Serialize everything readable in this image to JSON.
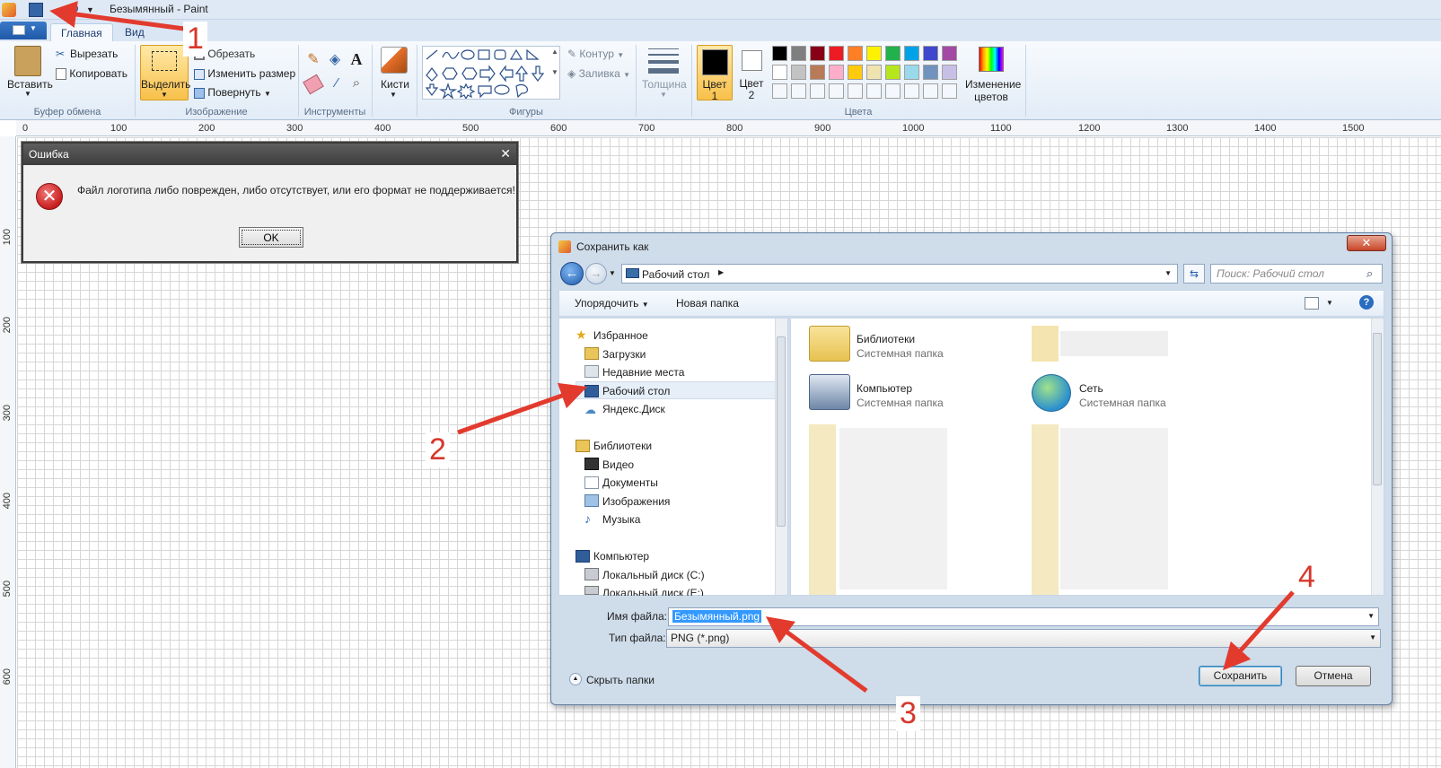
{
  "window": {
    "title": "Безымянный - Paint"
  },
  "tabs": {
    "home": "Главная",
    "view": "Вид"
  },
  "clipboard": {
    "paste": "Вставить",
    "cut": "Вырезать",
    "copy": "Копировать",
    "group": "Буфер обмена"
  },
  "image": {
    "select": "Выделить",
    "crop": "Обрезать",
    "resize": "Изменить размер",
    "rotate": "Повернуть",
    "group": "Изображение"
  },
  "tools": {
    "group": "Инструменты"
  },
  "brushes": {
    "label": "Кисти"
  },
  "shapes": {
    "outline": "Контур",
    "fill": "Заливка",
    "group": "Фигуры"
  },
  "thickness": {
    "label": "Толщина"
  },
  "colors": {
    "color1_line1": "Цвет",
    "color1_line2": "1",
    "color2_line1": "Цвет",
    "color2_line2": "2",
    "edit_line1": "Изменение",
    "edit_line2": "цветов",
    "group": "Цвета",
    "row1": [
      "#000000",
      "#7f7f7f",
      "#880015",
      "#ed1c24",
      "#ff7f27",
      "#fff200",
      "#22b14c",
      "#00a2e8",
      "#3f48cc",
      "#a349a4"
    ],
    "row2": [
      "#ffffff",
      "#c3c3c3",
      "#b97a57",
      "#ffaec9",
      "#ffc90e",
      "#efe4b0",
      "#b5e61d",
      "#99d9ea",
      "#7092be",
      "#c8bfe7"
    ]
  },
  "ruler": {
    "h": [
      "0",
      "100",
      "200",
      "300",
      "400",
      "500",
      "600",
      "700",
      "800",
      "900",
      "1000",
      "1100",
      "1200",
      "1300",
      "1400",
      "1500"
    ],
    "v": [
      "100",
      "200",
      "300",
      "400",
      "500",
      "600"
    ]
  },
  "error_dialog": {
    "title": "Ошибка",
    "message": "Файл логотипа либо поврежден, либо отсутствует, или его формат не поддерживается!",
    "ok": "OK"
  },
  "save_dialog": {
    "title": "Сохранить как",
    "address": "Рабочий стол",
    "search_placeholder": "Поиск: Рабочий стол",
    "organize": "Упорядочить",
    "new_folder": "Новая папка",
    "nav": {
      "favorites": "Избранное",
      "downloads": "Загрузки",
      "recent": "Недавние места",
      "desktop": "Рабочий стол",
      "yandex": "Яндекс.Диск",
      "libraries": "Библиотеки",
      "video": "Видео",
      "documents": "Документы",
      "pictures": "Изображения",
      "music": "Музыка",
      "computer": "Компьютер",
      "disk_c": "Локальный диск (C:)",
      "disk_e": "Локальный диск (E:)"
    },
    "items": [
      {
        "name": "Библиотеки",
        "type": "Системная папка"
      },
      {
        "name": "Компьютер",
        "type": "Системная папка"
      },
      {
        "name": "Сеть",
        "type": "Системная папка"
      }
    ],
    "filename_label": "Имя файла:",
    "filename": "Безымянный.png",
    "filetype_label": "Тип файла:",
    "filetype": "PNG (*.png)",
    "hide_folders": "Скрыть папки",
    "save": "Сохранить",
    "cancel": "Отмена"
  },
  "annotations": [
    "1",
    "2",
    "3",
    "4"
  ]
}
